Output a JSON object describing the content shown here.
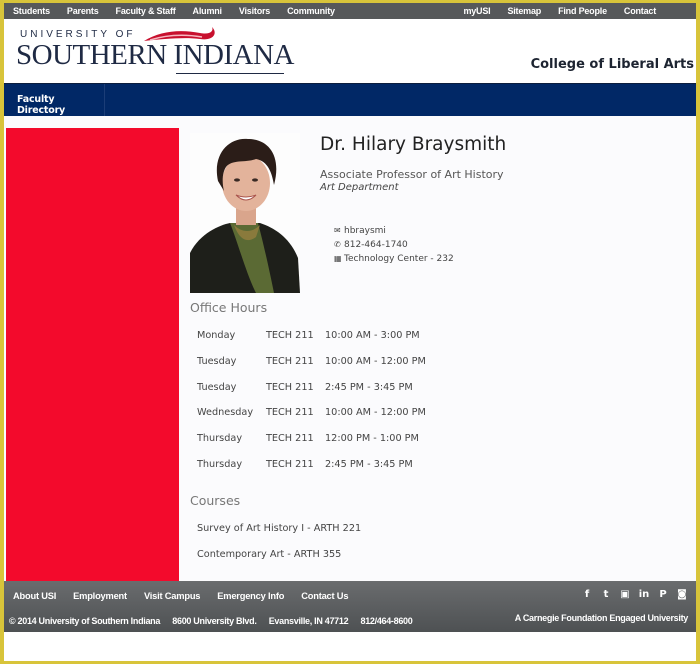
{
  "topnav": {
    "left": [
      "Students",
      "Parents",
      "Faculty & Staff",
      "Alumni",
      "Visitors",
      "Community"
    ],
    "right": [
      "myUSI",
      "Sitemap",
      "Find People",
      "Contact"
    ]
  },
  "header": {
    "logo_small": "UNIVERSITY OF",
    "logo_big": "SOUTHERN INDIANA",
    "college": "College of Liberal Arts"
  },
  "banner": {
    "item": "Faculty Directory"
  },
  "profile": {
    "name": "Dr. Hilary Braysmith",
    "title": "Associate Professor of Art History",
    "department": "Art Department",
    "email": "hbraysmi",
    "phone": "812-464-1740",
    "office": "Technology Center - 232",
    "icons": {
      "email": "envelope-icon",
      "phone": "phone-icon",
      "office": "building-icon"
    }
  },
  "office_hours": {
    "heading": "Office Hours",
    "rows": [
      {
        "day": "Monday",
        "room": "TECH 211",
        "time": "10:00 AM - 3:00 PM"
      },
      {
        "day": "Tuesday",
        "room": "TECH 211",
        "time": "10:00 AM - 12:00 PM"
      },
      {
        "day": "Tuesday",
        "room": "TECH 211",
        "time": "2:45 PM - 3:45 PM"
      },
      {
        "day": "Wednesday",
        "room": "TECH 211",
        "time": "10:00 AM - 12:00 PM"
      },
      {
        "day": "Thursday",
        "room": "TECH 211",
        "time": "12:00 PM - 1:00 PM"
      },
      {
        "day": "Thursday",
        "room": "TECH 211",
        "time": "2:45 PM - 3:45 PM"
      }
    ]
  },
  "courses": {
    "heading": "Courses",
    "items": [
      "Survey of Art History I - ARTH 221",
      "Contemporary Art - ARTH 355"
    ]
  },
  "footer": {
    "links": [
      "About USI",
      "Employment",
      "Visit Campus",
      "Emergency Info",
      "Contact Us"
    ],
    "copyright": "© 2014 University of Southern Indiana",
    "address": "8600 University Blvd.",
    "city": "Evansville, IN 47712",
    "phone": "812/464-8600",
    "tagline": "A Carnegie Foundation Engaged University",
    "social": [
      {
        "name": "facebook-icon",
        "glyph": "f"
      },
      {
        "name": "twitter-icon",
        "glyph": "t"
      },
      {
        "name": "youtube-icon",
        "glyph": "▣"
      },
      {
        "name": "linkedin-icon",
        "glyph": "in"
      },
      {
        "name": "pinterest-icon",
        "glyph": "P"
      },
      {
        "name": "instagram-icon",
        "glyph": "◙"
      }
    ]
  },
  "colors": {
    "frame": "#d8c43a",
    "topnav": "#56585a",
    "banner": "#012866",
    "red_block": "#f30a2c",
    "footer": "#5a5c5e"
  }
}
